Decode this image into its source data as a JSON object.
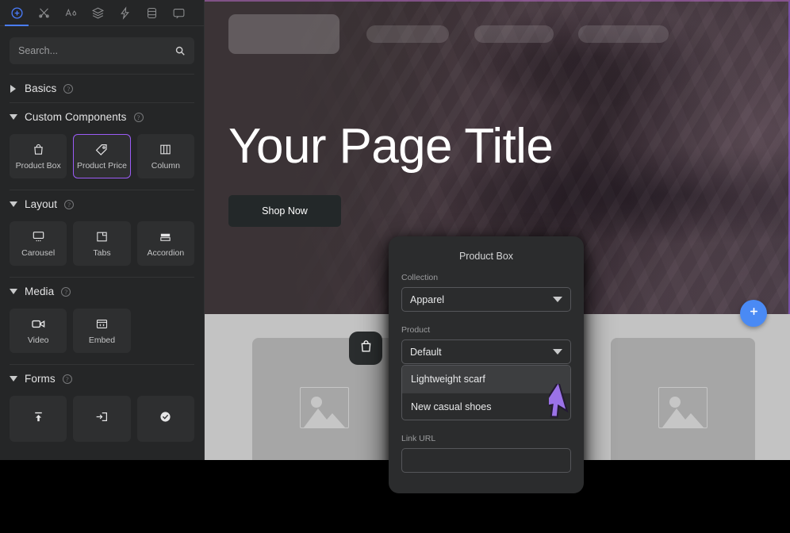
{
  "sidebar": {
    "toolbar": [
      {
        "name": "add-component-icon",
        "active": true
      },
      {
        "name": "design-tools-icon",
        "active": false
      },
      {
        "name": "typography-color-icon",
        "active": false
      },
      {
        "name": "layers-icon",
        "active": false
      },
      {
        "name": "interactions-icon",
        "active": false
      },
      {
        "name": "database-icon",
        "active": false
      },
      {
        "name": "comments-icon",
        "active": false
      }
    ],
    "search": {
      "value": "",
      "placeholder": "Search...",
      "icon": "search-icon"
    },
    "sections": [
      {
        "id": "basics",
        "label": "Basics",
        "expanded": false,
        "help": "?",
        "items": []
      },
      {
        "id": "custom-components",
        "label": "Custom Components",
        "expanded": true,
        "help": "?",
        "items": [
          {
            "label": "Product Box",
            "icon": "shopping-bag-icon",
            "selected": false
          },
          {
            "label": "Product Price",
            "icon": "price-tag-icon",
            "selected": true
          },
          {
            "label": "Column",
            "icon": "columns-icon",
            "selected": false
          }
        ]
      },
      {
        "id": "layout",
        "label": "Layout",
        "expanded": true,
        "help": "?",
        "items": [
          {
            "label": "Carousel",
            "icon": "carousel-icon",
            "selected": false
          },
          {
            "label": "Tabs",
            "icon": "tabs-icon",
            "selected": false
          },
          {
            "label": "Accordion",
            "icon": "accordion-icon",
            "selected": false
          }
        ]
      },
      {
        "id": "media",
        "label": "Media",
        "expanded": true,
        "help": "?",
        "items": [
          {
            "label": "Video",
            "icon": "video-camera-icon",
            "selected": false
          },
          {
            "label": "Embed",
            "icon": "embed-code-icon",
            "selected": false
          }
        ]
      },
      {
        "id": "forms",
        "label": "Forms",
        "expanded": true,
        "help": "?",
        "items": [
          {
            "label": "",
            "icon": "file-upload-icon",
            "selected": false
          },
          {
            "label": "",
            "icon": "input-field-icon",
            "selected": false
          },
          {
            "label": "",
            "icon": "checkbox-checked-icon",
            "selected": false
          }
        ]
      }
    ]
  },
  "canvas": {
    "hero": {
      "title": "Your Page Title",
      "button_label": "Shop Now",
      "nav_placeholders": 4,
      "background": "dark-purple-silk-fabric"
    },
    "products": {
      "cards": 3,
      "card_placeholder_icon": "image-placeholder-icon",
      "badge_icon": "shopping-bag-icon"
    },
    "add_button": {
      "icon": "plus-icon",
      "color": "#4a8af4"
    },
    "selection_outline_color": "#9b5cf6"
  },
  "modal": {
    "title": "Product Box",
    "fields": [
      {
        "label": "Collection",
        "type": "select",
        "value": "Apparel",
        "open": false,
        "options": []
      },
      {
        "label": "Product",
        "type": "select",
        "value": "Default",
        "open": true,
        "options": [
          {
            "label": "Lightweight scarf",
            "highlighted": true
          },
          {
            "label": "New casual shoes",
            "highlighted": false
          }
        ]
      },
      {
        "label": "Link URL",
        "type": "text",
        "value": "",
        "placeholder": ""
      }
    ]
  },
  "cursor": {
    "icon": "arrow-pointer-icon",
    "color": "#9b72e8"
  }
}
